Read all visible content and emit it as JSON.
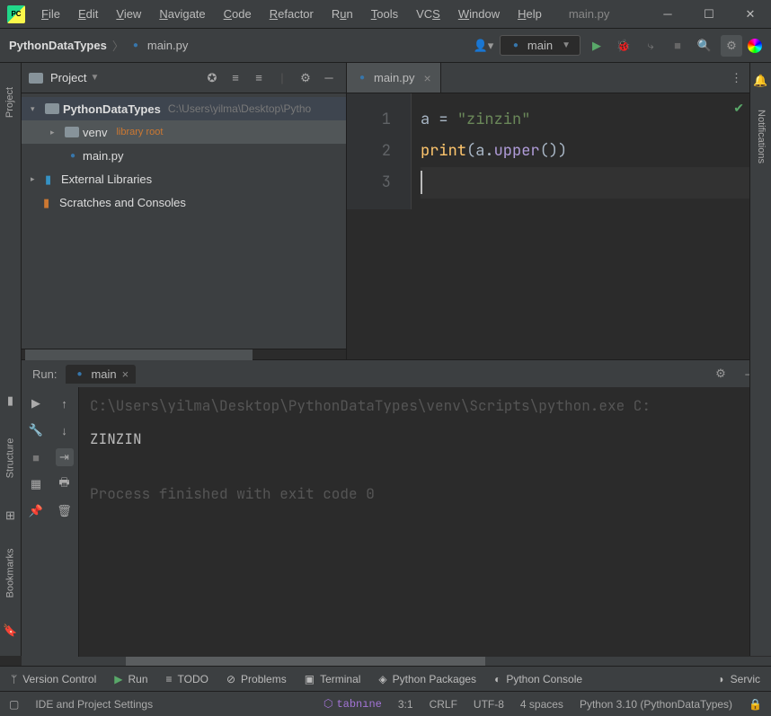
{
  "titlebar": {
    "file_name": "main.py",
    "menu": [
      "File",
      "Edit",
      "View",
      "Navigate",
      "Code",
      "Refactor",
      "Run",
      "Tools",
      "VCS",
      "Window",
      "Help"
    ]
  },
  "breadcrumb": {
    "project": "PythonDataTypes",
    "file": "main.py"
  },
  "runconfig": {
    "name": "main"
  },
  "project_pane": {
    "title": "Project",
    "root_name": "PythonDataTypes",
    "root_path": "C:\\Users\\yilma\\Desktop\\Pytho",
    "venv": "venv",
    "venv_note": "library root",
    "file1": "main.py",
    "ext_libs": "External Libraries",
    "scratches": "Scratches and Consoles"
  },
  "editor": {
    "tab": "main.py",
    "lines": [
      "1",
      "2",
      "3"
    ],
    "code": {
      "l1_id": "a",
      "l1_op": " = ",
      "l1_str": "\"zinzin\"",
      "l2_fn": "print",
      "l2_p1": "(",
      "l2_id": "a",
      "l2_dot": ".",
      "l2_call": "upper",
      "l2_p2": "(",
      "l2_p3": ")",
      "l2_p4": ")"
    }
  },
  "run": {
    "label": "Run:",
    "tab": "main",
    "cmdline": "C:\\Users\\yilma\\Desktop\\PythonDataTypes\\venv\\Scripts\\python.exe C:",
    "output": "ZINZIN",
    "exit": "Process finished with exit code 0"
  },
  "bottom_tabs": {
    "vc": "Version Control",
    "run": "Run",
    "todo": "TODO",
    "problems": "Problems",
    "terminal": "Terminal",
    "pkg": "Python Packages",
    "console": "Python Console",
    "services": "Servic"
  },
  "status": {
    "msg": "IDE and Project Settings",
    "tabnine": "tabnıne",
    "pos": "3:1",
    "sep": "CRLF",
    "enc": "UTF-8",
    "indent": "4 spaces",
    "interp": "Python 3.10 (PythonDataTypes)"
  },
  "side": {
    "project": "Project",
    "structure": "Structure",
    "bookmarks": "Bookmarks",
    "notif": "Notifications"
  }
}
